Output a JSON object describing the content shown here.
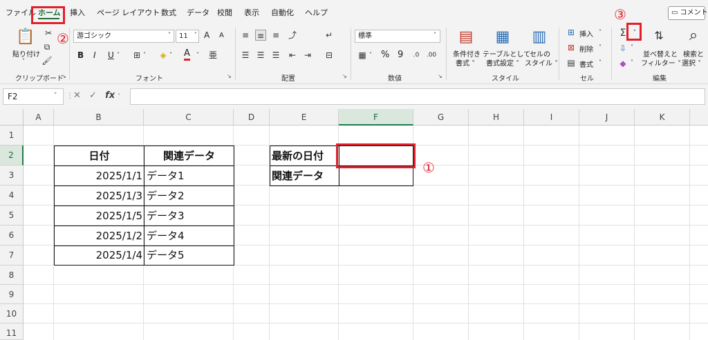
{
  "menu": {
    "tabs": [
      "ファイル",
      "ホーム",
      "挿入",
      "ページ レイアウト",
      "数式",
      "データ",
      "校閲",
      "表示",
      "自動化",
      "ヘルプ"
    ],
    "comment_button": "コメント"
  },
  "annotations": [
    "①",
    "②",
    "③"
  ],
  "ribbon": {
    "clipboard": {
      "paste": "貼り付け",
      "label": "クリップボード"
    },
    "font": {
      "name": "游ゴシック",
      "size": "11",
      "label": "フォント",
      "bold": "B",
      "italic": "I",
      "underline": "U",
      "font_color_letter": "A",
      "grow": "A",
      "shrink": "A"
    },
    "alignment": {
      "label": "配置"
    },
    "number": {
      "format": "標準",
      "label": "数値",
      "percent": "%",
      "comma": "9"
    },
    "styles": {
      "conditional": [
        "条件付き",
        "書式 ˅"
      ],
      "table": [
        "テーブルとして",
        "書式設定 ˅"
      ],
      "cell": [
        "セルの",
        "スタイル ˅"
      ],
      "label": "スタイル"
    },
    "cells": {
      "insert": "挿入",
      "delete": "削除",
      "format": "書式",
      "label": "セル"
    },
    "editing": {
      "sort": [
        "並べ替えと",
        "フィルター ˅"
      ],
      "find": [
        "検索と",
        "選択 ˅"
      ],
      "label": "編集"
    }
  },
  "formula_bar": {
    "name_box": "F2",
    "fx": "fx",
    "value": ""
  },
  "columns": [
    "A",
    "B",
    "C",
    "D",
    "E",
    "F",
    "G",
    "H",
    "I",
    "J",
    "K"
  ],
  "rows": [
    "1",
    "2",
    "3",
    "4",
    "5",
    "6",
    "7",
    "8",
    "9",
    "10",
    "11"
  ],
  "table": {
    "headers": [
      "日付",
      "関連データ"
    ],
    "rows": [
      [
        "2025/1/1",
        "データ1"
      ],
      [
        "2025/1/3",
        "データ2"
      ],
      [
        "2025/1/5",
        "データ3"
      ],
      [
        "2025/1/2",
        "データ4"
      ],
      [
        "2025/1/4",
        "データ5"
      ]
    ]
  },
  "lookup": {
    "latest_date_label": "最新の日付",
    "related_label": "関連データ",
    "latest_date_value": "",
    "related_value": ""
  },
  "colors": {
    "accent": "#1e6b3b",
    "highlight": "#e0202a"
  }
}
